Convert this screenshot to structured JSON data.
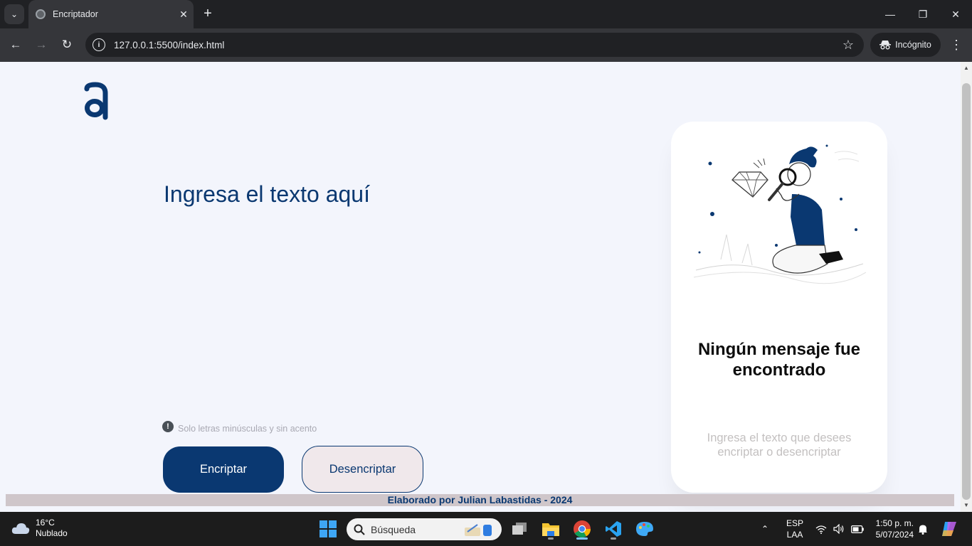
{
  "browser": {
    "tab_title": "Encriptador",
    "url": "127.0.0.1:5500/index.html",
    "incognito_label": "Incógnito"
  },
  "page": {
    "input_placeholder": "Ingresa el texto aquí",
    "hint_text": "Solo letras minúsculas y sin acento",
    "encrypt_button": "Encriptar",
    "decrypt_button": "Desencriptar",
    "card_title": "Ningún mensaje fue encontrado",
    "card_subtitle": "Ingresa el texto que desees encriptar o desencriptar",
    "footer_text": "Elaborado por Julian Labastidas - 2024"
  },
  "colors": {
    "primary": "#0a3871",
    "page_background": "#f3f5fc",
    "card_background": "#ffffff",
    "hint_text": "#a9a9b3"
  },
  "taskbar": {
    "weather_temp": "16°C",
    "weather_desc": "Nublado",
    "search_placeholder": "Búsqueda",
    "language_top": "ESP",
    "language_bottom": "LAA",
    "time": "1:50 p. m.",
    "date": "5/07/2024"
  }
}
